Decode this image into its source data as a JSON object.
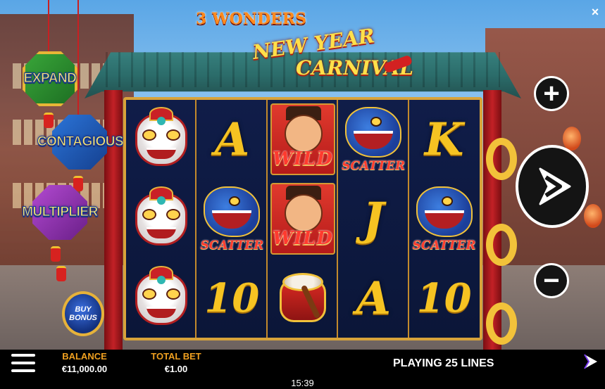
{
  "game": {
    "brand": "3 WONDERS",
    "title_line1": "NEW YEAR",
    "title_line2": "CARNIVAL"
  },
  "features": {
    "expand": "EXPAND",
    "contagious": "CONTAGIOUS",
    "multiplier": "MULTIPLIER"
  },
  "buy_bonus": {
    "label": "BUY\nBONUS"
  },
  "reels": [
    [
      "lion-dancer-icon",
      "lion-dancer-icon",
      "lion-dancer-icon"
    ],
    [
      "A",
      "scatter",
      "10"
    ],
    [
      "wild",
      "wild",
      "drum-icon"
    ],
    [
      "scatter",
      "J",
      "A"
    ],
    [
      "K",
      "scatter",
      "10"
    ]
  ],
  "symbols": {
    "wild_text": "WILD",
    "scatter_text": "SCATTER",
    "reel1_row1": "A",
    "reel1_row3": "10",
    "reel3_row2": "J",
    "reel3_row3": "A",
    "reel4_row1": "K",
    "reel4_row3": "10"
  },
  "controls": {
    "plus": "+",
    "minus": "−",
    "close": "×",
    "spin_icon": "spin-icon"
  },
  "bottom_bar": {
    "balance_label": "BALANCE",
    "balance_value": "€11,000.00",
    "total_bet_label": "TOTAL BET",
    "total_bet_value": "€1.00",
    "lines_text": "PLAYING 25 LINES",
    "clock": "15:39"
  },
  "colors": {
    "gold": "#f6c322",
    "frame": "#d8a33a",
    "stat_label": "#f0a020"
  }
}
